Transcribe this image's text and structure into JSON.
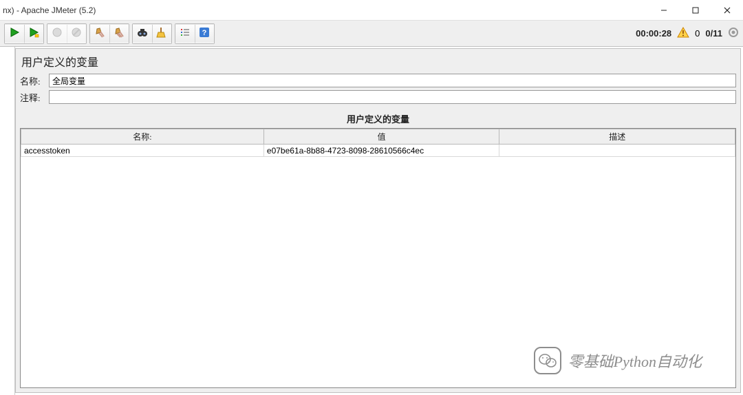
{
  "window": {
    "title": "nx) - Apache JMeter (5.2)"
  },
  "toolbar": {
    "groups": [
      [
        {
          "name": "run-button",
          "icon": "play",
          "disabled": false
        },
        {
          "name": "run-no-pause-button",
          "icon": "play-sub",
          "disabled": false
        }
      ],
      [
        {
          "name": "stop-button",
          "icon": "stop",
          "disabled": true
        },
        {
          "name": "shutdown-button",
          "icon": "shutdown",
          "disabled": true
        }
      ],
      [
        {
          "name": "clear-button",
          "icon": "broom1",
          "disabled": false
        },
        {
          "name": "clear-all-button",
          "icon": "broom2",
          "disabled": false
        }
      ],
      [
        {
          "name": "search-button",
          "icon": "binoculars",
          "disabled": false
        },
        {
          "name": "reset-search-button",
          "icon": "broom3",
          "disabled": false
        }
      ],
      [
        {
          "name": "function-helper-button",
          "icon": "list",
          "disabled": false
        },
        {
          "name": "help-button",
          "icon": "help",
          "disabled": false
        }
      ]
    ],
    "status": {
      "elapsed": "00:00:28",
      "warnings": "0",
      "threads": "0/11"
    }
  },
  "panel": {
    "title": "用户定义的变量",
    "name_label": "名称:",
    "name_value": "全局变量",
    "comment_label": "注释:",
    "comment_value": "",
    "section_heading": "用户定义的变量",
    "table": {
      "headers": {
        "name": "名称:",
        "value": "值",
        "desc": "描述"
      },
      "rows": [
        {
          "name": "accesstoken",
          "value": "e07be61a-8b88-4723-8098-28610566c4ec",
          "desc": ""
        }
      ]
    }
  },
  "watermark": {
    "text": "零基础Python自动化"
  }
}
